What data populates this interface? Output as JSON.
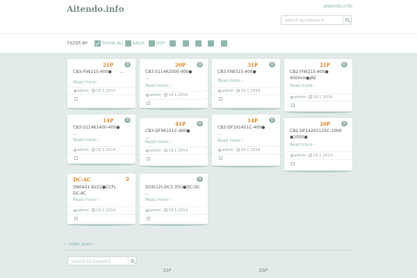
{
  "header": {
    "logo": "Aitendo.info",
    "toplink": "aitendo.info",
    "search_placeholder": "search by keyword"
  },
  "filter": {
    "label": "FILTER BY:",
    "items": [
      {
        "label": "SHOW ALL",
        "checked": true
      },
      {
        "label": "ANUX",
        "checked": false
      },
      {
        "label": "DSP",
        "checked": false
      },
      {
        "label": "",
        "checked": false
      },
      {
        "label": "",
        "checked": false
      },
      {
        "label": "",
        "checked": false
      },
      {
        "label": "",
        "checked": false
      },
      {
        "label": "",
        "checked": false
      }
    ]
  },
  "posts": [
    {
      "price": "21P",
      "badge": "0",
      "title": "CB3-FIW21S-400●",
      "title2": "...",
      "readmore": "Read more ›",
      "author": "admin",
      "date": "19 1 2015"
    },
    {
      "price": "20P",
      "badge": "0",
      "title": "CB3-S11462000-400●",
      "title2": "...",
      "readmore": "Read more ›",
      "author": "admin",
      "date": "19 1 2014"
    },
    {
      "price": "31P",
      "badge": "0",
      "title": "CB3-FIW31S-400●",
      "title2": "...",
      "readmore": "Read more ›",
      "author": "admin",
      "date": "19 1 2014"
    },
    {
      "price": "21P",
      "badge": "0",
      "title": "CB2-FIW21S-400●",
      "title2": "400mm●JAE",
      "readmore": "Read more ›",
      "author": "admin",
      "date": "19 1 2014"
    },
    {
      "price": "14P",
      "badge": "0",
      "title": "CB3-S11461400-400●",
      "title2": "...",
      "readmore": "Read more ›",
      "author": "admin",
      "date": "19 1 2014"
    },
    {
      "price": "41P",
      "badge": "0",
      "title": "CB3-DF94151C-400●",
      "title2": "...",
      "readmore": "Read more ›",
      "author": "admin",
      "date": "19 1 2014"
    },
    {
      "price": "14P",
      "badge": "0",
      "title": "CB3-DF191451C-400●",
      "title2": "...",
      "readmore": "Read more ›",
      "author": "admin",
      "date": "19 1 2014"
    },
    {
      "price": "20P",
      "badge": "0",
      "title": "CB2-DF14205125C-1000",
      "title2": "●1000●",
      "readmore": "Read more ›",
      "author": "admin",
      "date": "19 1 2014"
    },
    {
      "price": "DC-AC",
      "badge": "2",
      "title": "DN0421-6222●CCFL",
      "title2": "DC-AC",
      "readmore": "Read more ›",
      "author": "admin",
      "date": "19 1 2014"
    },
    {
      "price": "",
      "badge": "0",
      "title": "DC6(12)-DC3.3(5)●DC-DC",
      "title2": "...",
      "readmore": "Read more ›",
      "author": "admin",
      "date": "19 1 2014"
    }
  ],
  "pagination": {
    "older": "← Older posts"
  },
  "footer": {
    "search_placeholder": "search by keyword",
    "link1": "21P",
    "link2": "DSP"
  }
}
